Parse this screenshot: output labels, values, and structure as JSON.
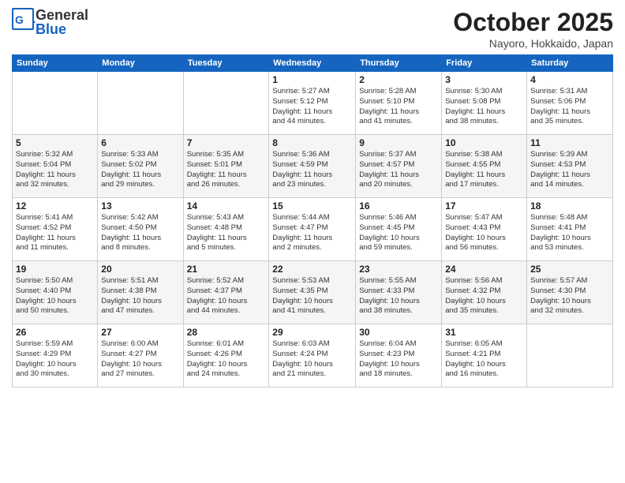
{
  "header": {
    "logo_general": "General",
    "logo_blue": "Blue",
    "month": "October 2025",
    "location": "Nayoro, Hokkaido, Japan"
  },
  "days_of_week": [
    "Sunday",
    "Monday",
    "Tuesday",
    "Wednesday",
    "Thursday",
    "Friday",
    "Saturday"
  ],
  "weeks": [
    [
      {
        "day": "",
        "info": ""
      },
      {
        "day": "",
        "info": ""
      },
      {
        "day": "",
        "info": ""
      },
      {
        "day": "1",
        "info": "Sunrise: 5:27 AM\nSunset: 5:12 PM\nDaylight: 11 hours\nand 44 minutes."
      },
      {
        "day": "2",
        "info": "Sunrise: 5:28 AM\nSunset: 5:10 PM\nDaylight: 11 hours\nand 41 minutes."
      },
      {
        "day": "3",
        "info": "Sunrise: 5:30 AM\nSunset: 5:08 PM\nDaylight: 11 hours\nand 38 minutes."
      },
      {
        "day": "4",
        "info": "Sunrise: 5:31 AM\nSunset: 5:06 PM\nDaylight: 11 hours\nand 35 minutes."
      }
    ],
    [
      {
        "day": "5",
        "info": "Sunrise: 5:32 AM\nSunset: 5:04 PM\nDaylight: 11 hours\nand 32 minutes."
      },
      {
        "day": "6",
        "info": "Sunrise: 5:33 AM\nSunset: 5:02 PM\nDaylight: 11 hours\nand 29 minutes."
      },
      {
        "day": "7",
        "info": "Sunrise: 5:35 AM\nSunset: 5:01 PM\nDaylight: 11 hours\nand 26 minutes."
      },
      {
        "day": "8",
        "info": "Sunrise: 5:36 AM\nSunset: 4:59 PM\nDaylight: 11 hours\nand 23 minutes."
      },
      {
        "day": "9",
        "info": "Sunrise: 5:37 AM\nSunset: 4:57 PM\nDaylight: 11 hours\nand 20 minutes."
      },
      {
        "day": "10",
        "info": "Sunrise: 5:38 AM\nSunset: 4:55 PM\nDaylight: 11 hours\nand 17 minutes."
      },
      {
        "day": "11",
        "info": "Sunrise: 5:39 AM\nSunset: 4:53 PM\nDaylight: 11 hours\nand 14 minutes."
      }
    ],
    [
      {
        "day": "12",
        "info": "Sunrise: 5:41 AM\nSunset: 4:52 PM\nDaylight: 11 hours\nand 11 minutes."
      },
      {
        "day": "13",
        "info": "Sunrise: 5:42 AM\nSunset: 4:50 PM\nDaylight: 11 hours\nand 8 minutes."
      },
      {
        "day": "14",
        "info": "Sunrise: 5:43 AM\nSunset: 4:48 PM\nDaylight: 11 hours\nand 5 minutes."
      },
      {
        "day": "15",
        "info": "Sunrise: 5:44 AM\nSunset: 4:47 PM\nDaylight: 11 hours\nand 2 minutes."
      },
      {
        "day": "16",
        "info": "Sunrise: 5:46 AM\nSunset: 4:45 PM\nDaylight: 10 hours\nand 59 minutes."
      },
      {
        "day": "17",
        "info": "Sunrise: 5:47 AM\nSunset: 4:43 PM\nDaylight: 10 hours\nand 56 minutes."
      },
      {
        "day": "18",
        "info": "Sunrise: 5:48 AM\nSunset: 4:41 PM\nDaylight: 10 hours\nand 53 minutes."
      }
    ],
    [
      {
        "day": "19",
        "info": "Sunrise: 5:50 AM\nSunset: 4:40 PM\nDaylight: 10 hours\nand 50 minutes."
      },
      {
        "day": "20",
        "info": "Sunrise: 5:51 AM\nSunset: 4:38 PM\nDaylight: 10 hours\nand 47 minutes."
      },
      {
        "day": "21",
        "info": "Sunrise: 5:52 AM\nSunset: 4:37 PM\nDaylight: 10 hours\nand 44 minutes."
      },
      {
        "day": "22",
        "info": "Sunrise: 5:53 AM\nSunset: 4:35 PM\nDaylight: 10 hours\nand 41 minutes."
      },
      {
        "day": "23",
        "info": "Sunrise: 5:55 AM\nSunset: 4:33 PM\nDaylight: 10 hours\nand 38 minutes."
      },
      {
        "day": "24",
        "info": "Sunrise: 5:56 AM\nSunset: 4:32 PM\nDaylight: 10 hours\nand 35 minutes."
      },
      {
        "day": "25",
        "info": "Sunrise: 5:57 AM\nSunset: 4:30 PM\nDaylight: 10 hours\nand 32 minutes."
      }
    ],
    [
      {
        "day": "26",
        "info": "Sunrise: 5:59 AM\nSunset: 4:29 PM\nDaylight: 10 hours\nand 30 minutes."
      },
      {
        "day": "27",
        "info": "Sunrise: 6:00 AM\nSunset: 4:27 PM\nDaylight: 10 hours\nand 27 minutes."
      },
      {
        "day": "28",
        "info": "Sunrise: 6:01 AM\nSunset: 4:26 PM\nDaylight: 10 hours\nand 24 minutes."
      },
      {
        "day": "29",
        "info": "Sunrise: 6:03 AM\nSunset: 4:24 PM\nDaylight: 10 hours\nand 21 minutes."
      },
      {
        "day": "30",
        "info": "Sunrise: 6:04 AM\nSunset: 4:23 PM\nDaylight: 10 hours\nand 18 minutes."
      },
      {
        "day": "31",
        "info": "Sunrise: 6:05 AM\nSunset: 4:21 PM\nDaylight: 10 hours\nand 16 minutes."
      },
      {
        "day": "",
        "info": ""
      }
    ]
  ]
}
